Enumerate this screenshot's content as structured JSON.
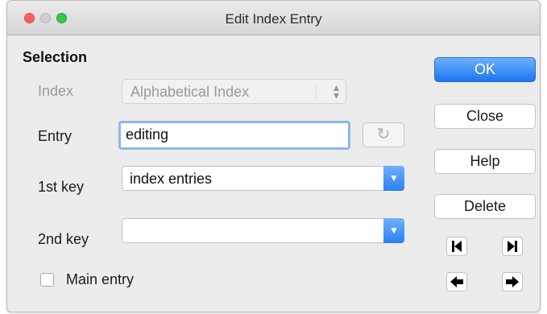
{
  "window": {
    "title": "Edit Index Entry"
  },
  "selection": {
    "heading": "Selection",
    "index_label": "Index",
    "index_value": "Alphabetical Index",
    "entry_label": "Entry",
    "entry_value": "editing",
    "key1_label": "1st key",
    "key1_value": "index entries",
    "key2_label": "2nd key",
    "key2_value": "",
    "main_entry_label": "Main entry",
    "main_entry_checked": false
  },
  "buttons": {
    "ok": "OK",
    "close": "Close",
    "help": "Help",
    "delete": "Delete"
  },
  "icons": {
    "window_close": "close-dot-icon",
    "window_minimize": "minimize-dot-icon",
    "window_maximize": "maximize-dot-icon",
    "phonetic": "rotate-icon",
    "first": "skip-first-icon",
    "last": "skip-last-icon",
    "previous": "arrow-left-icon",
    "next": "arrow-right-icon"
  },
  "colors": {
    "accent": "#2c7ff3",
    "focus_ring": "#8fb6ec",
    "traffic_close": "#fc605c",
    "traffic_max": "#34c84a"
  }
}
